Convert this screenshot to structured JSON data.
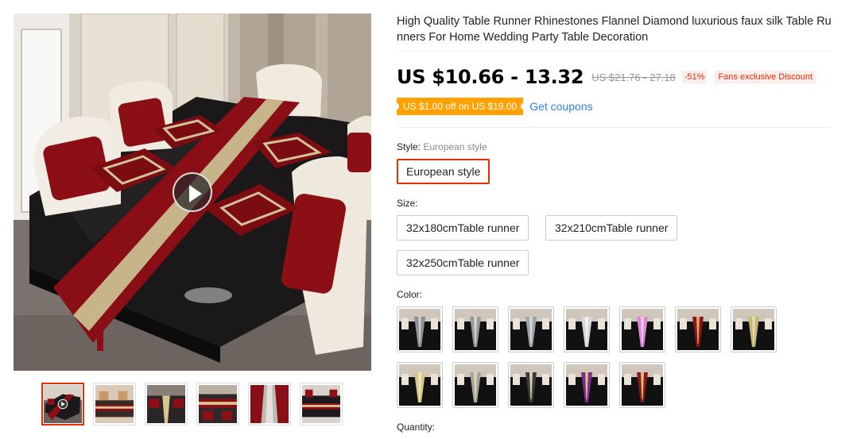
{
  "product": {
    "title": "High Quality Table Runner Rhinestones Flannel Diamond luxurious faux silk Table Runners For Home Wedding Party Table Decoration",
    "price": "US $10.66 - 13.32",
    "old_price": "US $21.76 - 27.18",
    "discount": "-51%",
    "fans_discount": "Fans exclusive Discount",
    "coupon_tag": "US $1.00 off on US $19.00",
    "get_coupons": "Get coupons"
  },
  "style": {
    "label": "Style:",
    "value": "European style",
    "options": [
      "European style"
    ]
  },
  "size": {
    "label": "Size:",
    "options": [
      "32x180cmTable runner",
      "32x210cmTable runner",
      "32x250cmTable runner"
    ]
  },
  "color": {
    "label": "Color:",
    "swatches": [
      {
        "runner": "#8d8f94",
        "accent": "#c9c9c9",
        "selected": false
      },
      {
        "runner": "#9a9a9d",
        "accent": "#d3d3d3",
        "selected": false
      },
      {
        "runner": "#9fa3ab",
        "accent": "#d8d8d8",
        "selected": false
      },
      {
        "runner": "#d7d7d7",
        "accent": "#f2f2f2",
        "selected": false
      },
      {
        "runner": "#d98ad3",
        "accent": "#f3c6ef",
        "selected": false
      },
      {
        "runner": "#8e1218",
        "accent": "#d3b06a",
        "selected": false
      },
      {
        "runner": "#c9b77a",
        "accent": "#e8dcae",
        "selected": false
      },
      {
        "runner": "#d6c98a",
        "accent": "#f0e7bd",
        "selected": false
      },
      {
        "runner": "#a3a3a3",
        "accent": "#e0d7a8",
        "selected": false
      },
      {
        "runner": "#3d3a3a",
        "accent": "#d8d2b6",
        "selected": false
      },
      {
        "runner": "#7c2c86",
        "accent": "#d2c08a",
        "selected": false
      },
      {
        "runner": "#8a1b1b",
        "accent": "#e0c07a",
        "selected": false
      }
    ]
  },
  "quantity": {
    "label": "Quantity:"
  },
  "gallery": {
    "thumb_count": 6,
    "active_index": 0
  },
  "colors": {
    "accent_red": "#e62e04",
    "coupon_orange": "#ffa100",
    "link_blue": "#2f80ed"
  }
}
